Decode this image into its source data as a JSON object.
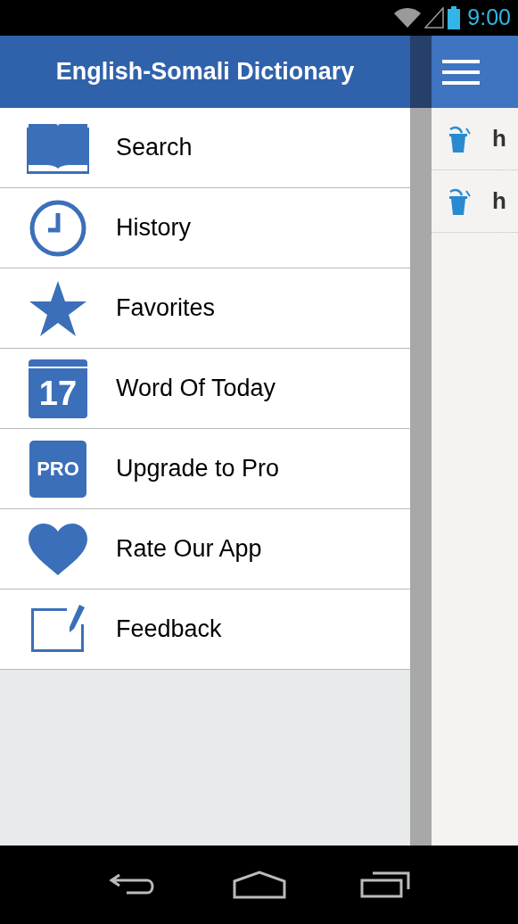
{
  "status_bar": {
    "time": "9:00"
  },
  "drawer": {
    "title": "English-Somali Dictionary",
    "items": [
      {
        "kind": "book",
        "label": "Search"
      },
      {
        "kind": "clock",
        "label": "History"
      },
      {
        "kind": "star",
        "label": "Favorites"
      },
      {
        "kind": "calendar",
        "label": "Word Of Today",
        "badge": "17"
      },
      {
        "kind": "pro",
        "label": "Upgrade to Pro",
        "badge": "PRO"
      },
      {
        "kind": "heart",
        "label": "Rate Our App"
      },
      {
        "kind": "note",
        "label": "Feedback"
      }
    ]
  },
  "main": {
    "rows": [
      {
        "text": "h"
      },
      {
        "text": "h"
      }
    ]
  }
}
